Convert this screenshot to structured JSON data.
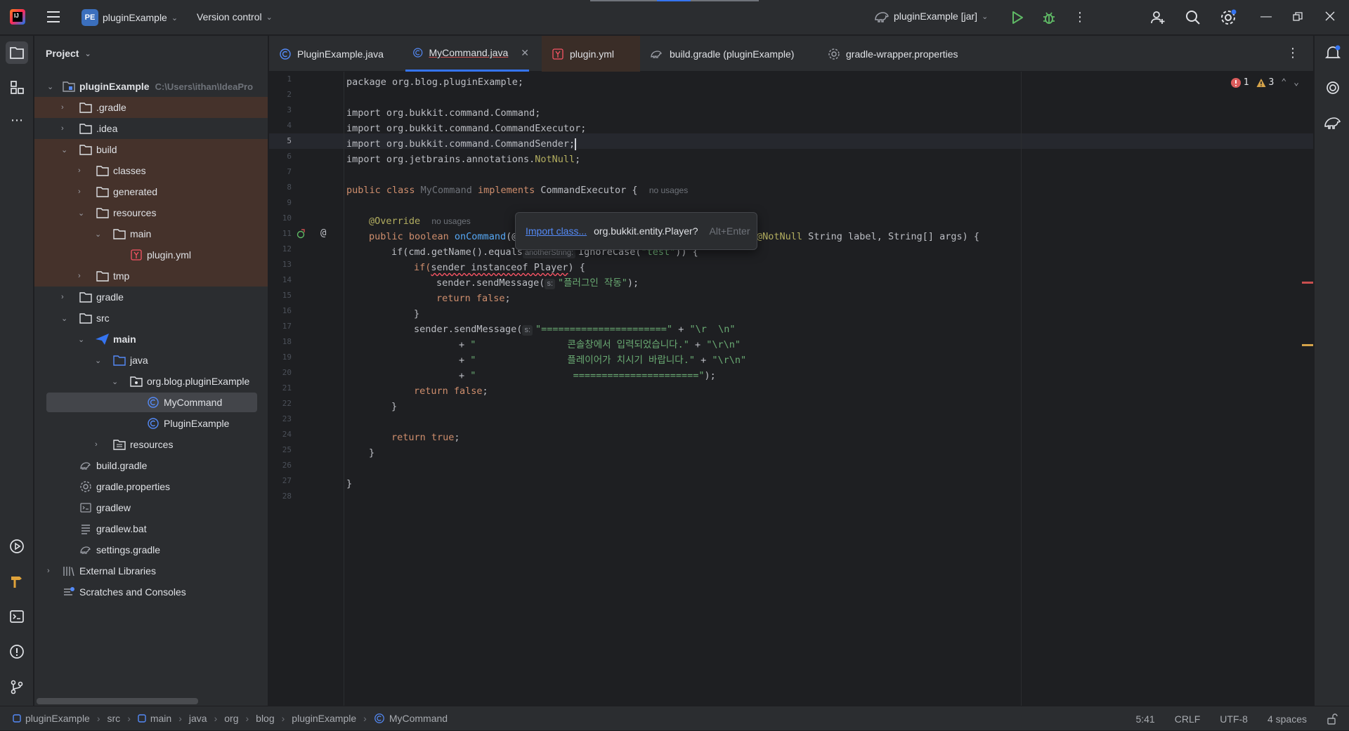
{
  "titlebar": {
    "project_badge": "PE",
    "project_name": "pluginExample",
    "vcs_label": "Version control",
    "run_config": "pluginExample [jar]"
  },
  "project_panel": {
    "title": "Project",
    "root_name": "pluginExample",
    "root_path": "C:\\Users\\ithan\\IdeaPro",
    "items": {
      "gradle_dot": ".gradle",
      "idea": ".idea",
      "build": "build",
      "classes": "classes",
      "generated": "generated",
      "resources_build": "resources",
      "main_build": "main",
      "plugin_yml": "plugin.yml",
      "tmp": "tmp",
      "gradle": "gradle",
      "src": "src",
      "main_src": "main",
      "java": "java",
      "package": "org.blog.pluginExample",
      "mycommand": "MyCommand",
      "pluginexample": "PluginExample",
      "resources_src": "resources",
      "build_gradle": "build.gradle",
      "gradle_properties": "gradle.properties",
      "gradlew": "gradlew",
      "gradlew_bat": "gradlew.bat",
      "settings_gradle": "settings.gradle",
      "external_libraries": "External Libraries",
      "scratches": "Scratches and Consoles"
    }
  },
  "tabs": {
    "t1": "PluginExample.java",
    "t2": "MyCommand.java",
    "t3": "plugin.yml",
    "t4": "build.gradle (pluginExample)",
    "t5": "gradle-wrapper.properties"
  },
  "inspections": {
    "errors": "1",
    "warnings": "3"
  },
  "code": {
    "l1": "package org.blog.pluginExample;",
    "l3": "import org.bukkit.command.Command;",
    "l4": "import org.bukkit.command.CommandExecutor;",
    "l5": "import org.bukkit.command.CommandSender;",
    "l6a": "import org.jetbrains.annotations.",
    "l6b": "NotNull",
    "l6c": ";",
    "l8_kw": "public class ",
    "l8_name": "MyCommand",
    "l8_impl": " implements ",
    "l8_iface": "CommandExecutor {",
    "no_usages": "no usages",
    "l10": "@Override",
    "l11_kw": "public boolean ",
    "l11_fn": "onCommand",
    "l11_open": "(@",
    "l11_ann": "@NotNull",
    "l11_rest": " String label, String[] args) {",
    "l12a": "if(cmd.getName().equals",
    "l12_hint": "anotherString:",
    "l12_b": "IgnoreCase(",
    "l12_str": "\"test\"",
    "l12_c": ")) {",
    "l13a": "if(",
    "l13_err": "sender instanceof Player",
    "l13b": ") {",
    "l14a": "sender.sendMessage(",
    "l14_hint": "s:",
    "l14_str": "\"플러그인 작동\"",
    "l14b": ");",
    "l15_kw": "return false",
    "l15b": ";",
    "l16": "}",
    "l17a": "sender.sendMessage(",
    "l17_hint": "s:",
    "l17_str": "\"======================\"",
    "l17b": " + ",
    "l17_str2": "\"\\r  \\n\"",
    "l18a": "+ ",
    "l18_str": "\"                콘솔창에서 입력되었습니다.\"",
    "l18b": " + ",
    "l18_str2": "\"\\r\\n\"",
    "l19a": "+ ",
    "l19_str": "\"                플레이어가 치시기 바랍니다.\"",
    "l19b": " + ",
    "l19_str2": "\"\\r\\n\"",
    "l20a": "+ ",
    "l20_str": "\"                 ======================\"",
    "l20b": ");",
    "l21_kw": "return false",
    "l21b": ";",
    "l22": "}",
    "l24_kw": "return true",
    "l24b": ";",
    "l25": "}",
    "l27": "}"
  },
  "popup": {
    "link": "Import class...",
    "class_name": "org.bukkit.entity.Player?",
    "shortcut": "Alt+Enter"
  },
  "statusbar": {
    "crumbs": [
      "pluginExample",
      "src",
      "main",
      "java",
      "org",
      "blog",
      "pluginExample",
      "MyCommand"
    ],
    "position": "5:41",
    "line_sep": "CRLF",
    "encoding": "UTF-8",
    "indent": "4 spaces"
  },
  "colors": {
    "accent": "#3574f0",
    "excluded_bg": "#45322b",
    "error": "#f75464",
    "warning": "#d5a34a",
    "keyword": "#cf8e6d",
    "string": "#6aab73"
  }
}
